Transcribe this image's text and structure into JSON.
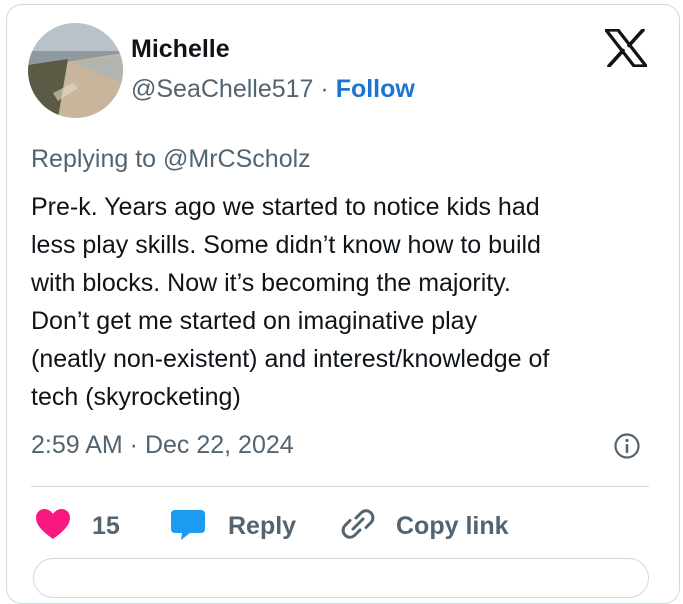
{
  "author": {
    "display_name": "Michelle",
    "handle": "@SeaChelle517",
    "separator": "·",
    "follow_label": "Follow"
  },
  "reply_context": {
    "prefix": "Replying to",
    "target": "@MrCScholz"
  },
  "tweet": {
    "lines": [
      "Pre-k. Years ago we started to notice kids had",
      "less play skills. Some didn’t know how to build",
      "with blocks. Now it’s becoming the majority.",
      "Don’t get me started on imaginative play",
      "(neatly non-existent) and interest/knowledge of",
      "tech (skyrocketing)"
    ],
    "timestamp": "2:59 AM · Dec 22, 2024"
  },
  "actions": {
    "like_count": "15",
    "reply_label": "Reply",
    "copy_link_label": "Copy link"
  },
  "icons": {
    "logo": "x-logo-icon",
    "info": "info-icon",
    "like": "heart-icon",
    "reply": "speech-bubble-icon",
    "copy": "link-icon"
  },
  "colors": {
    "link_blue": "#1d75d1",
    "heart_pink": "#f91880",
    "reply_blue": "#1d9bf0",
    "secondary_text": "#536471",
    "border": "#cfd9de"
  }
}
